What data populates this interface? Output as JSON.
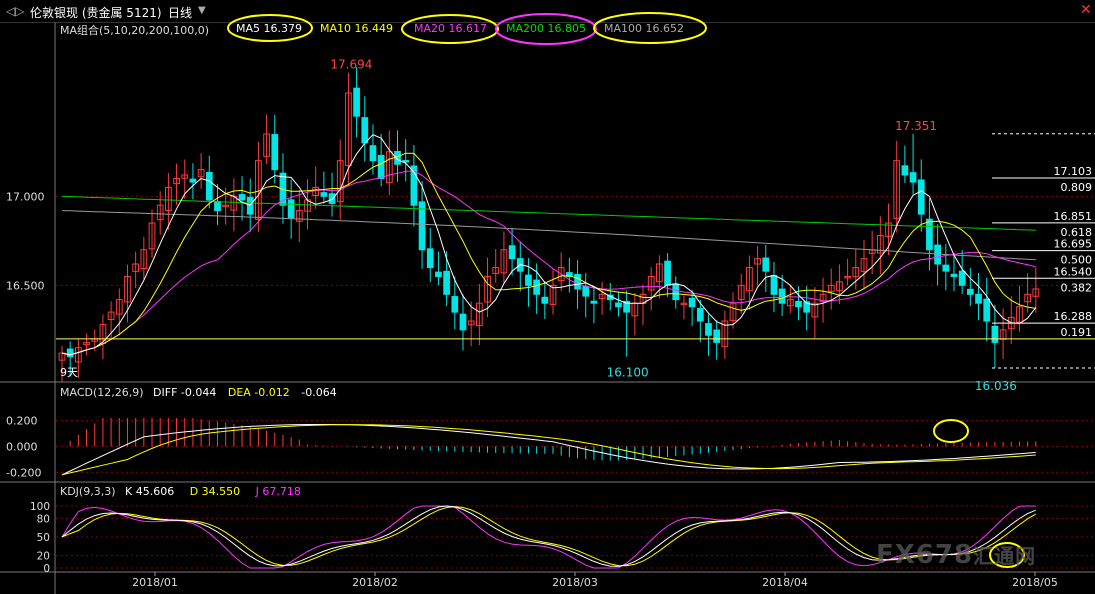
{
  "header": {
    "back_icon": "chevron-left-right-icon",
    "title": "伦敦银现 (贵金属 5121)",
    "period": "日线",
    "period_icon": "chevron-down-icon",
    "close_icon": "close-icon"
  },
  "indicators": {
    "ma_title": "MA组合(5,10,20,200,100,0)",
    "ma5": "MA5 16.379",
    "ma10": "MA10 16.449",
    "ma20": "MA20 16.617",
    "ma200": "MA200 16.805",
    "ma100": "MA100 16.652",
    "macd_title": "MACD(12,26,9)",
    "diff": "DIFF -0.044",
    "dea": "DEA -0.012",
    "macd": "-0.064",
    "kdj_title": "KDJ(9,3,3)",
    "k": "K 45.606",
    "d": "D 34.550",
    "j": "J 67.718"
  },
  "colors": {
    "up": "#ff3a3a",
    "down": "#00e5e5",
    "ma5": "#ffffff",
    "ma10": "#ffff00",
    "ma20": "#ff33ff",
    "ma200": "#00cc00",
    "ma100": "#999999",
    "highlight": "#ffff00",
    "grid": "#8b0000",
    "fib": "#ffffff"
  },
  "chart_data": {
    "type": "candlestick",
    "price_axis": {
      "ticks": [
        "17.000",
        "16.500"
      ],
      "range": [
        15.98,
        17.9
      ]
    },
    "x_axis": {
      "ticks": [
        "2018/01",
        "2018/02",
        "2018/03",
        "2018/04",
        "2018/05"
      ]
    },
    "annotations": {
      "high_1": "17.694",
      "high_2": "17.351",
      "low_1": "16.100",
      "low_2": "16.036",
      "days_label": "9天"
    },
    "fib_levels": [
      {
        "price": "17.103",
        "ratio": "0.809"
      },
      {
        "price": "16.851",
        "ratio": "0.618"
      },
      {
        "price": "16.695",
        "ratio": "0.500"
      },
      {
        "price": "16.540",
        "ratio": "0.382"
      },
      {
        "price": "16.288",
        "ratio": "0.191"
      }
    ],
    "support_line": 16.2,
    "macd_axis": {
      "ticks": [
        "0.200",
        "0.000",
        "-0.200"
      ]
    },
    "kdj_axis": {
      "ticks": [
        "100",
        "80",
        "50",
        "20",
        "0"
      ]
    }
  },
  "watermark": "FX678",
  "watermark_suffix": "汇通网"
}
